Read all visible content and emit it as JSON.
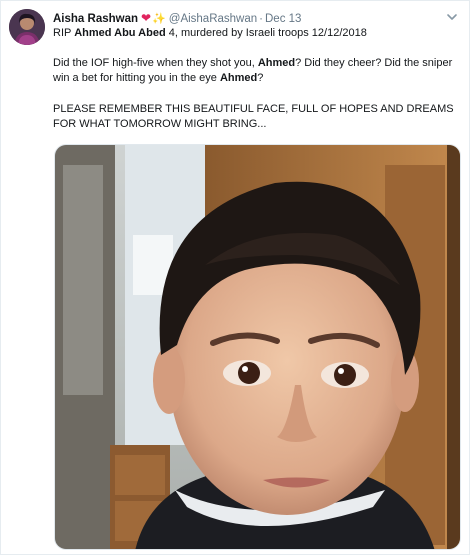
{
  "tweet": {
    "author_name": "Aisha Rashwan",
    "author_emoji_heart": "❤",
    "author_emoji_sparkle": "✨",
    "handle": "@AishaRashwan",
    "separator": "·",
    "date": "Dec 13",
    "line1": {
      "prefix": "RIP ",
      "bold_name": "Ahmed Abu Abed",
      "suffix": " 4, murdered by Israeli troops 12/12/2018"
    },
    "para2": {
      "part1": "Did the IOF high-five when they shot you, ",
      "bold1": "Ahmed",
      "part2": "? Did they cheer? Did the sniper win a bet for hitting you in the eye ",
      "bold2": "Ahmed",
      "part3": "?"
    },
    "para3": "PLEASE REMEMBER THIS BEAUTIFUL FACE, FULL OF HOPES AND DREAMS FOR WHAT TOMORROW MIGHT BRING...",
    "icons": {
      "menu": "chevron-down-icon",
      "avatar": "avatar"
    },
    "colors": {
      "heart": "#e0245e",
      "sparkle": "#ffac33",
      "secondary_text": "#657786"
    }
  }
}
